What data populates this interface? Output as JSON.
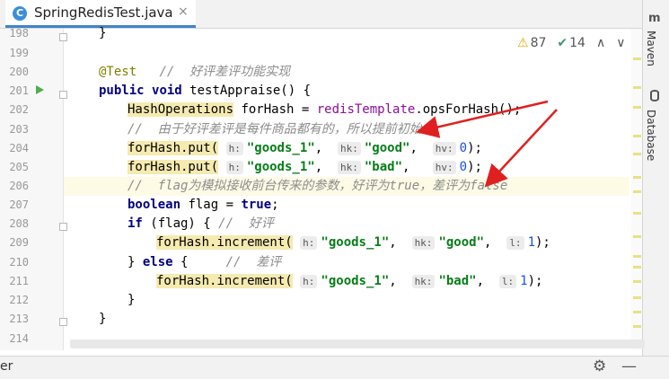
{
  "tab": {
    "icon_letter": "C",
    "title": "SpringRedisTest.java",
    "close": "×"
  },
  "inspections": {
    "warning_icon": "warning-triangle",
    "warnings": "87",
    "ok_icon": "double-check",
    "passed": "14",
    "up": "∧",
    "down": "∨"
  },
  "side_panels": {
    "maven": "Maven",
    "database": "Database"
  },
  "line_numbers": [
    "198",
    "199",
    "200",
    "201",
    "202",
    "203",
    "204",
    "205",
    "206",
    "207",
    "208",
    "209",
    "210",
    "211",
    "212",
    "213",
    "214"
  ],
  "code": {
    "l198": "}",
    "l200_annotation": "@Test",
    "l200_comment": "//  好评差评功能实现",
    "l201_kw1": "public",
    "l201_kw2": "void",
    "l201_rest": " testAppraise() {",
    "l202_type": "HashOperations",
    "l202_mid": " forHash = ",
    "l202_field": "redisTemplate",
    "l202_end": ".opsForHash();",
    "l203_comment": "//  由于好评差评是每件商品都有的，所以提前初始化",
    "l204_call": "forHash.put(",
    "l204_h": "h:",
    "l204_s1": "\"goods_1\"",
    "l204_hk": "hk:",
    "l204_s2": "\"good\"",
    "l204_hv": "hv:",
    "l204_n": "0",
    "l204_end": ");",
    "l205_call": "forHash.put(",
    "l205_h": "h:",
    "l205_s1": "\"goods_1\"",
    "l205_hk": "hk:",
    "l205_s2": "\"bad\"",
    "l205_hv": "hv:",
    "l205_n": "0",
    "l205_end": ");",
    "l206_comment": "//  flag为模拟接收前台传来的参数，好评为true，差评为false",
    "l207_kw": "boolean",
    "l207_mid": " flag = ",
    "l207_val": "true",
    "l207_end": ";",
    "l208_kw": "if",
    "l208_rest": " (flag) { ",
    "l208_comment": "//  好评",
    "l209_call": "forHash.increment(",
    "l209_h": "h:",
    "l209_s1": "\"goods_1\"",
    "l209_hk": "hk:",
    "l209_s2": "\"good\"",
    "l209_l": "l:",
    "l209_n": "1",
    "l209_end": ");",
    "l210_open": "} ",
    "l210_kw": "else",
    "l210_rest": " {     ",
    "l210_comment": "//  差评",
    "l211_call": "forHash.increment(",
    "l211_h": "h:",
    "l211_s1": "\"goods_1\"",
    "l211_hk": "hk:",
    "l211_s2": "\"bad\"",
    "l211_l": "l:",
    "l211_n": "1",
    "l211_end": ");",
    "l212": "}",
    "l213": "}"
  },
  "bottom": {
    "left_text": "er",
    "gear_icon": "gear-icon",
    "gear": "⚙",
    "minimize": "—"
  },
  "colors": {
    "accent": "#4083c9",
    "keyword": "#000080",
    "string": "#067d17",
    "annotation": "#808000",
    "comment": "#8c8c8c",
    "arrow": "#e02020"
  }
}
